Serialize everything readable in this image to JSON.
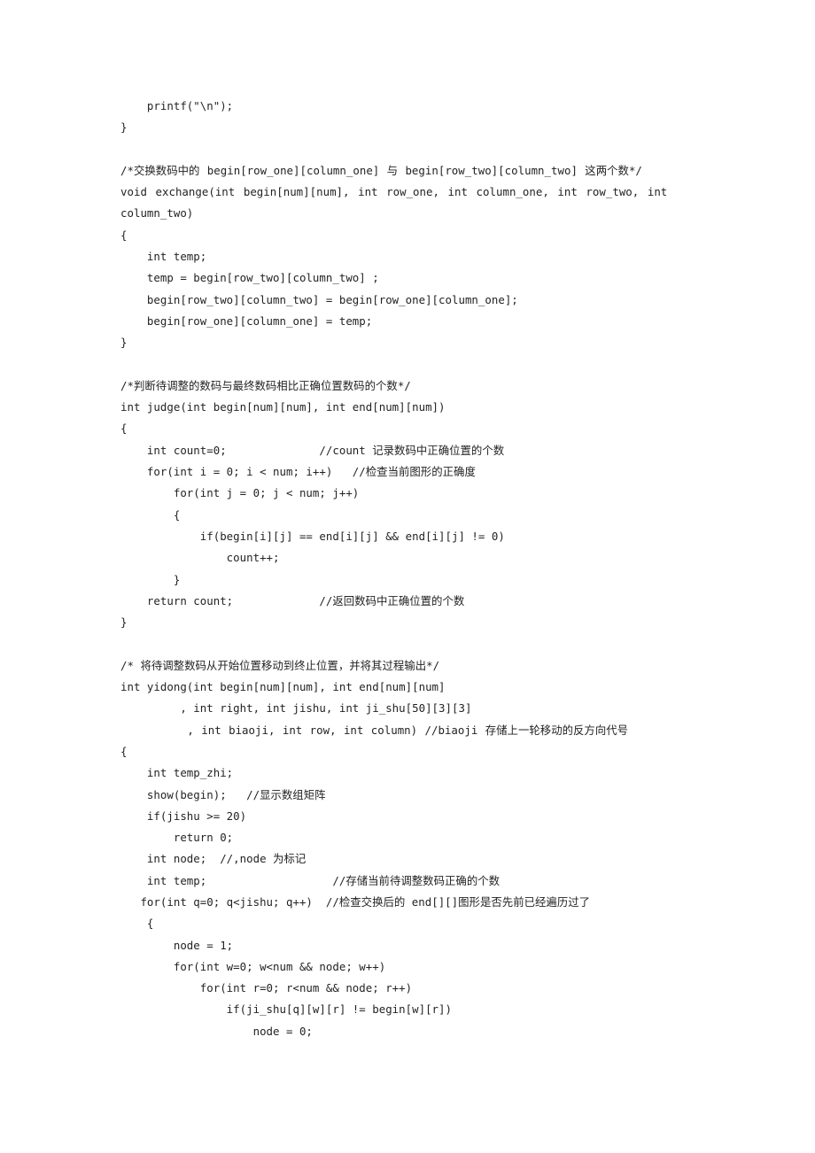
{
  "document": {
    "type": "source-code-listing",
    "language": "C",
    "background_color": "#ffffff",
    "text_color": "#232323"
  },
  "code": {
    "lines": [
      "    printf(\"\\n\");",
      "}",
      "",
      "/*交换数码中的 begin[row_one][column_one] 与 begin[row_two][column_two] 这两个数*/",
      "void exchange(int begin[num][num], int row_one, int column_one, int row_two, int",
      "column_two)",
      "{",
      "    int temp;",
      "    temp = begin[row_two][column_two] ;",
      "    begin[row_two][column_two] = begin[row_one][column_one];",
      "    begin[row_one][column_one] = temp;",
      "}",
      "",
      "/*判断待调整的数码与最终数码相比正确位置数码的个数*/",
      "int judge(int begin[num][num], int end[num][num])",
      "{",
      "    int count=0;              //count 记录数码中正确位置的个数",
      "    for(int i = 0; i < num; i++)   //检查当前图形的正确度",
      "        for(int j = 0; j < num; j++)",
      "        {",
      "            if(begin[i][j] == end[i][j] && end[i][j] != 0)",
      "                count++;",
      "        }",
      "    return count;             //返回数码中正确位置的个数",
      "}",
      "",
      "/* 将待调整数码从开始位置移动到终止位置，并将其过程输出*/",
      "int yidong(int begin[num][num], int end[num][num]",
      "         , int right, int jishu, int ji_shu[50][3][3]",
      "         , int biaoji, int row, int column) //biaoji 存储上一轮移动的反方向代号",
      "{",
      "    int temp_zhi;",
      "    show(begin);   //显示数组矩阵",
      "    if(jishu >= 20)",
      "        return 0;",
      "    int node;  //,node 为标记",
      "    int temp;                   //存储当前待调整数码正确的个数",
      "   for(int q=0; q<jishu; q++)  //检查交换后的 end[][]图形是否先前已经遍历过了",
      "    {",
      "        node = 1;",
      "        for(int w=0; w<num && node; w++)",
      "            for(int r=0; r<num && node; r++)",
      "                if(ji_shu[q][w][r] != begin[w][r])",
      "                    node = 0;"
    ],
    "justified_line_indices": [
      4
    ],
    "justified_lite_line_indices": [
      3,
      29
    ]
  }
}
